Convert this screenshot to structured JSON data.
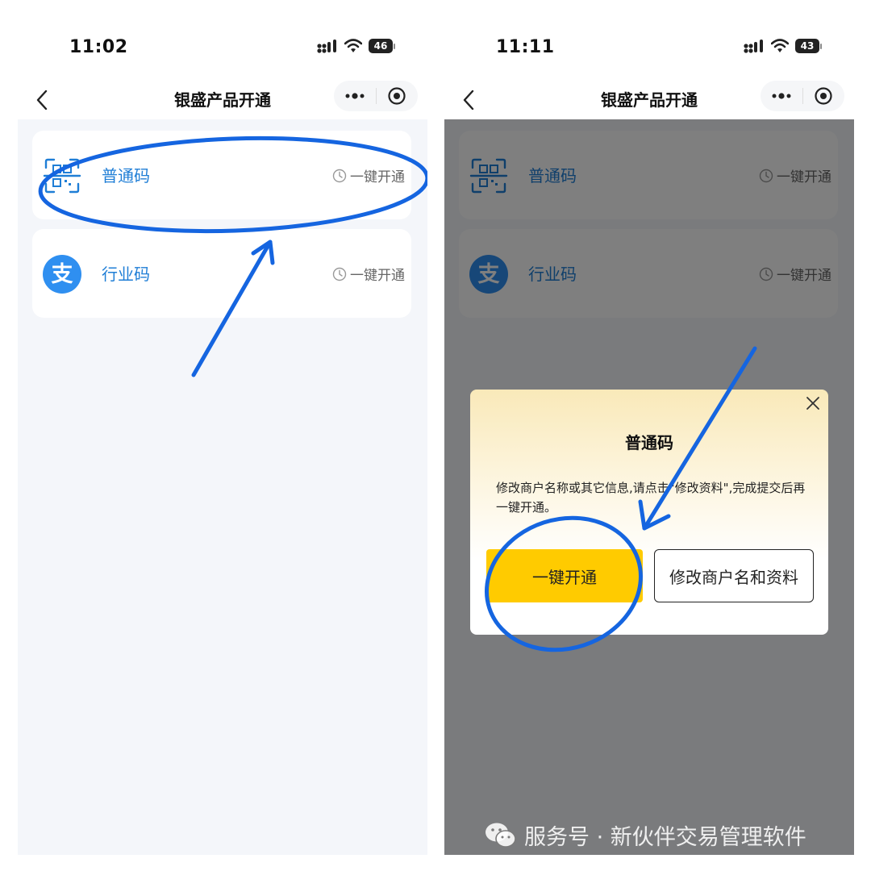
{
  "app": {
    "title": "银盛产品开通"
  },
  "screens": [
    {
      "status": {
        "time": "11:02",
        "battery": "46"
      },
      "cards": [
        {
          "label": "普通码",
          "icon": "qr-code-icon",
          "action": "一键开通"
        },
        {
          "label": "行业码",
          "icon": "alipay-icon",
          "action": "一键开通"
        }
      ]
    },
    {
      "status": {
        "time": "11:11",
        "battery": "43"
      },
      "cards": [
        {
          "label": "普通码",
          "icon": "qr-code-icon",
          "action": "一键开通"
        },
        {
          "label": "行业码",
          "icon": "alipay-icon",
          "action": "一键开通"
        }
      ],
      "modal": {
        "title": "普通码",
        "body": "修改商户名称或其它信息,请点击\"修改资料\",完成提交后再一键开通。",
        "primary": "一键开通",
        "secondary": "修改商户名和资料"
      }
    }
  ],
  "watermark": "服务号 · 新伙伴交易管理软件",
  "colors": {
    "accent_blue": "#1f7ed6",
    "annotation_blue": "#1565e0",
    "button_yellow": "#ffcb00",
    "page_bg": "#f4f6fa"
  },
  "icons": [
    "back-icon",
    "more-dots-icon",
    "target-icon",
    "qr-code-icon",
    "alipay-icon",
    "clock-icon",
    "close-icon",
    "signal-icon",
    "wifi-icon",
    "wechat-icon"
  ]
}
